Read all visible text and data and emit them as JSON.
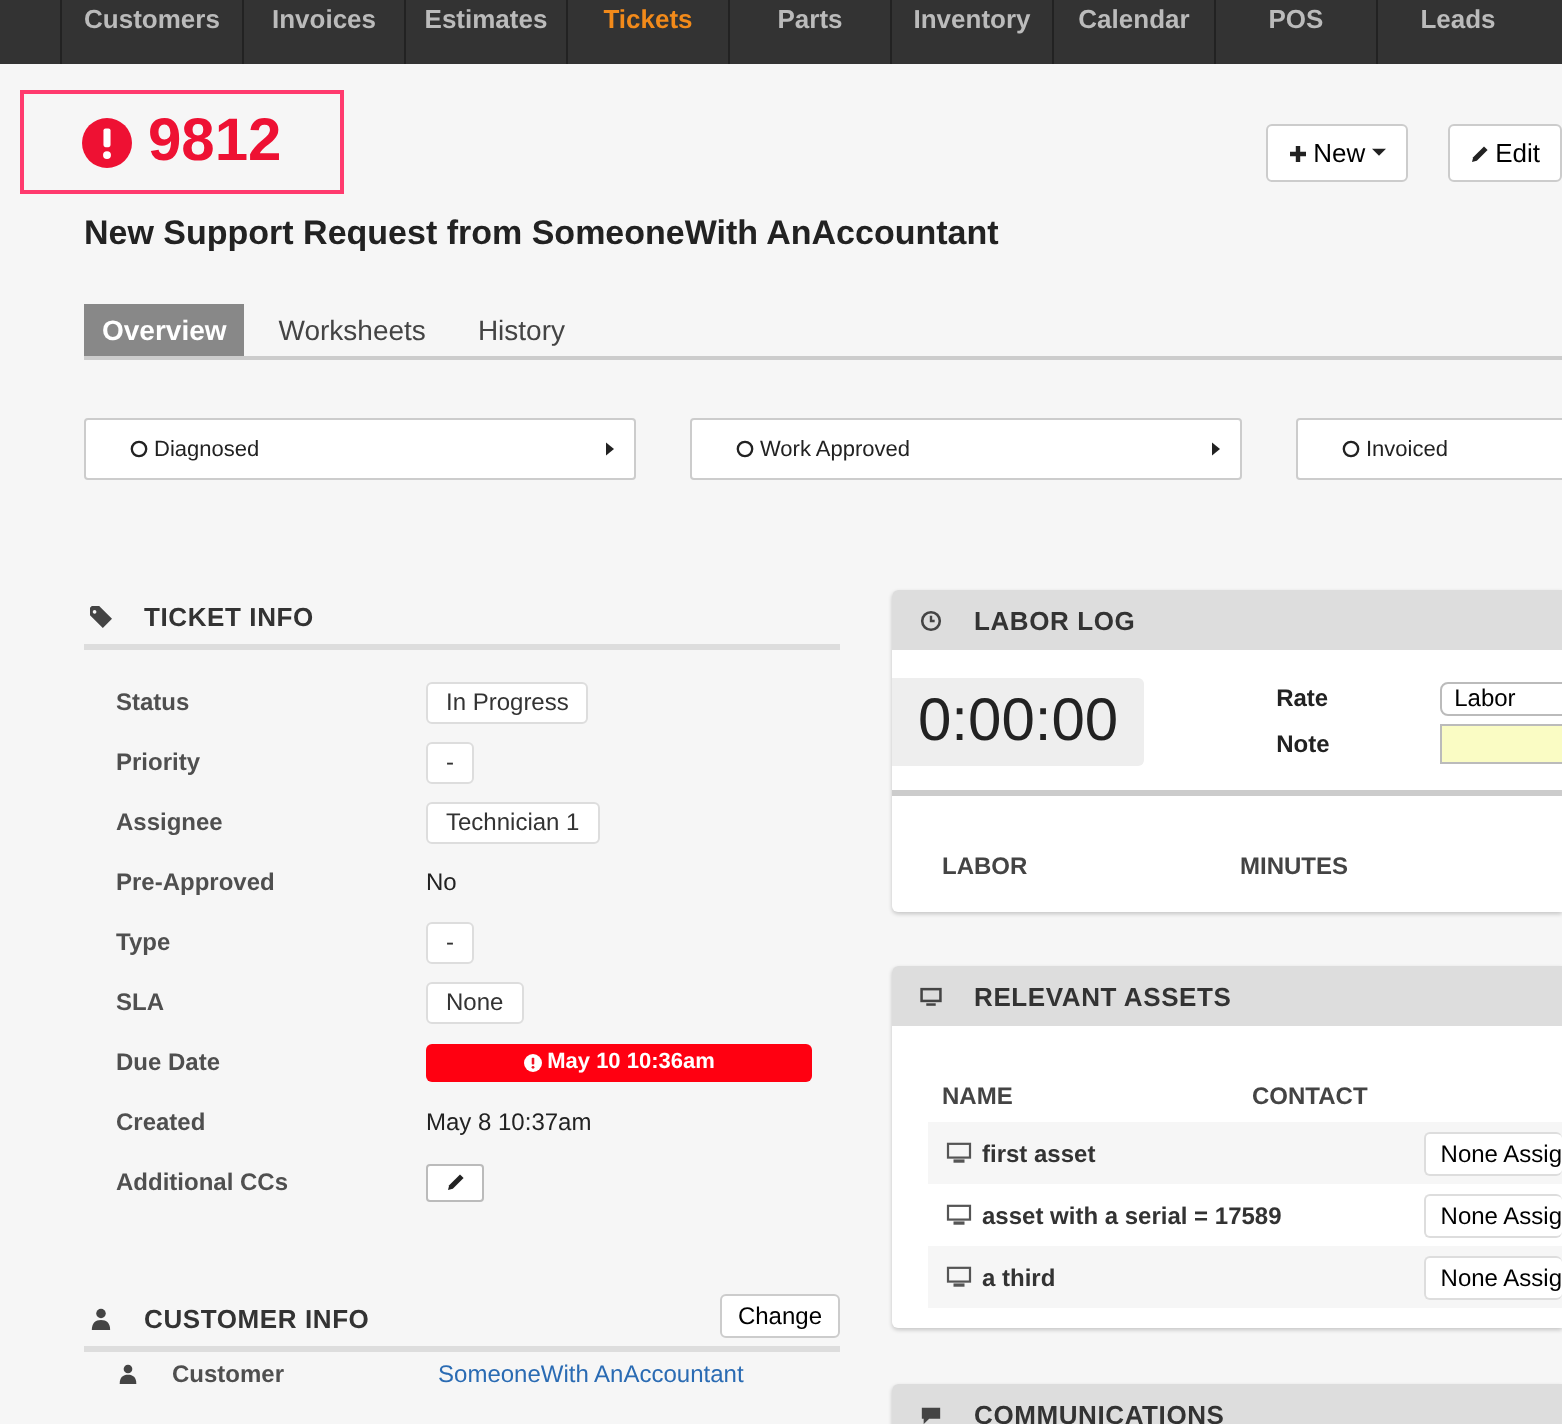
{
  "nav": [
    {
      "label": "Customers",
      "selected": false
    },
    {
      "label": "Invoices",
      "selected": false
    },
    {
      "label": "Estimates",
      "selected": false
    },
    {
      "label": "Tickets",
      "selected": true
    },
    {
      "label": "Parts",
      "selected": false
    },
    {
      "label": "Inventory",
      "selected": false
    },
    {
      "label": "Calendar",
      "selected": false
    },
    {
      "label": "POS",
      "selected": false
    },
    {
      "label": "Leads",
      "selected": false
    }
  ],
  "ticket": {
    "number": "9812",
    "subject": "New Support Request from SomeoneWith AnAccountant"
  },
  "actions": [
    {
      "kind": "new",
      "label": "New"
    },
    {
      "kind": "edit",
      "label": "Edit"
    }
  ],
  "tabs": [
    {
      "label": "Overview",
      "selected": true
    },
    {
      "label": "Worksheets",
      "selected": false
    },
    {
      "label": "History",
      "selected": false
    }
  ],
  "stages": [
    {
      "label": "Diagnosed"
    },
    {
      "label": "Work Approved"
    },
    {
      "label": "Invoiced"
    }
  ],
  "ticket_info": {
    "title": "TICKET INFO",
    "rows": [
      {
        "label": "Status",
        "kind": "pill",
        "value": "In Progress"
      },
      {
        "label": "Priority",
        "kind": "pill",
        "value": "-"
      },
      {
        "label": "Assignee",
        "kind": "pill",
        "value": "Technician 1"
      },
      {
        "label": "Pre-Approved",
        "kind": "text",
        "value": "No"
      },
      {
        "label": "Type",
        "kind": "pill",
        "value": "-"
      },
      {
        "label": "SLA",
        "kind": "pill",
        "value": "None"
      },
      {
        "label": "Due Date",
        "kind": "alert",
        "value": "May 10 10:36am"
      },
      {
        "label": "Created",
        "kind": "text",
        "value": "May 8 10:37am"
      },
      {
        "label": "Additional CCs",
        "kind": "edit"
      }
    ]
  },
  "customer_info": {
    "title": "CUSTOMER INFO",
    "button": "Change",
    "rows": [
      {
        "label": "Customer",
        "value": "SomeoneWith AnAccountant"
      }
    ]
  },
  "labor_log": {
    "title": "LABOR LOG",
    "timer": "0:00:00",
    "rate_label": "Rate",
    "rate_value": "Labor",
    "note_label": "Note",
    "columns": [
      "LABOR",
      "MINUTES"
    ]
  },
  "relevant_assets": {
    "title": "RELEVANT ASSETS",
    "columns": [
      "NAME",
      "CONTACT"
    ],
    "rows": [
      {
        "name": "first asset",
        "contact": "None Assig"
      },
      {
        "name": "asset with a serial = 17589",
        "contact": "None Assig"
      },
      {
        "name": "a third",
        "contact": "None Assig"
      }
    ]
  },
  "communications": {
    "title": "COMMUNICATIONS"
  }
}
